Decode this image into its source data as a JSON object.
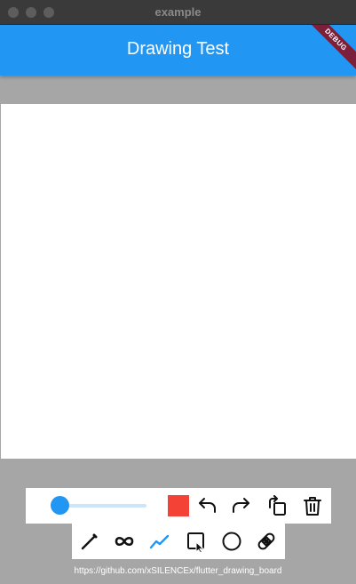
{
  "window": {
    "title": "example"
  },
  "appbar": {
    "title": "Drawing Test",
    "debug_label": "DEBUG"
  },
  "colors": {
    "primary": "#2196f3",
    "selected_color": "#f44336",
    "background": "#a6a6a6"
  },
  "toolbar": {
    "stroke_slider": {
      "value": 0.1
    },
    "actions": [
      "undo-icon",
      "redo-icon",
      "rotate-icon",
      "trash-icon"
    ]
  },
  "tools": {
    "items": [
      "pen-icon",
      "infinity-icon",
      "polyline-icon",
      "rectangle-icon",
      "circle-icon",
      "eraser-icon"
    ],
    "selected": "polyline-icon"
  },
  "footer": {
    "url": "https://github.com/xSILENCEx/flutter_drawing_board"
  }
}
